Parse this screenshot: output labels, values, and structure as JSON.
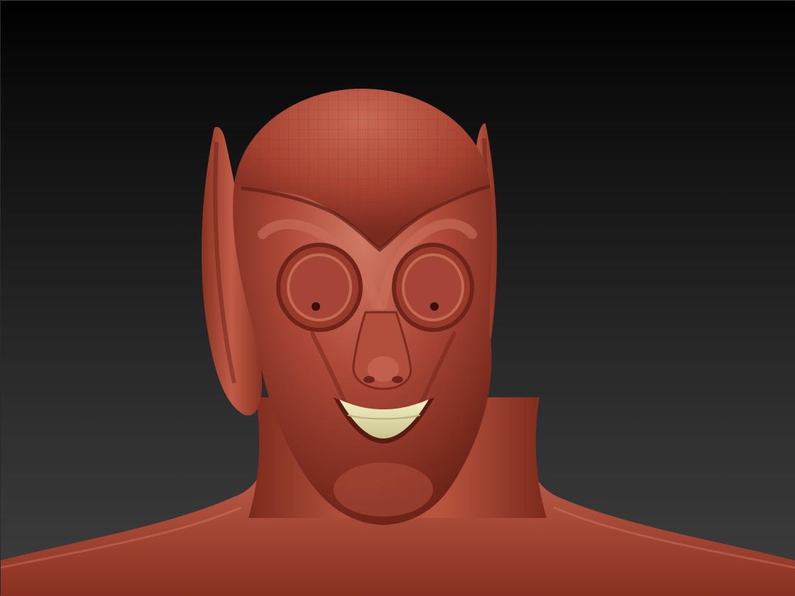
{
  "viewport": {
    "background_top": "#000000",
    "background_bottom": "#3d3d3d"
  },
  "model": {
    "icon": "goblin-head-sculpt",
    "material_color": "#b04a3a",
    "material_shadow": "#6e2418",
    "material_highlight": "#d9826f",
    "teeth_color": "#e6e3b0"
  }
}
